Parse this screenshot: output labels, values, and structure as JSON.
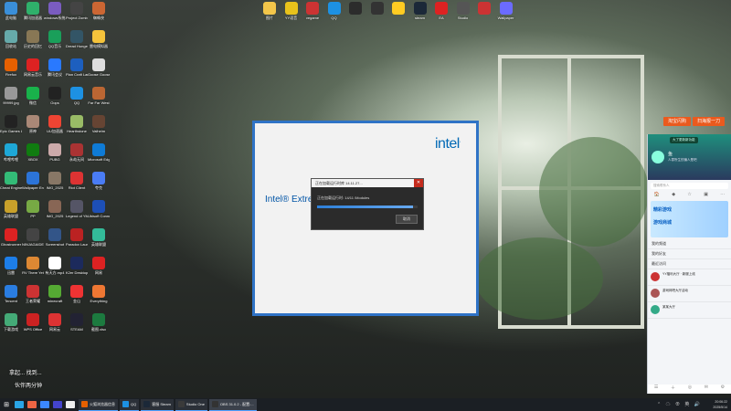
{
  "desktop_icons": [
    {
      "label": "此电脑",
      "color": "#3a8fd9"
    },
    {
      "label": "腾讯加速器",
      "color": "#2fb06b"
    },
    {
      "label": "windows系统.rar",
      "color": "#7a5cc0"
    },
    {
      "label": "Project Zomboid",
      "color": "#444"
    },
    {
      "label": "蜘蛛侠",
      "color": "#c63"
    },
    {
      "label": "回收站",
      "color": "#6aa"
    },
    {
      "label": "历史的回忆",
      "color": "#875"
    },
    {
      "label": "QQ音乐",
      "color": "#1a9f5a"
    },
    {
      "label": "Dread Hunger",
      "color": "#356"
    },
    {
      "label": "雷电模拟器",
      "color": "#f5c33b"
    },
    {
      "label": "Firefox",
      "color": "#e66000"
    },
    {
      "label": "网易云音乐",
      "color": "#d22"
    },
    {
      "label": "腾讯会议",
      "color": "#2979ff"
    },
    {
      "label": "Plan Craft Launcher",
      "color": "#1d5fbf"
    },
    {
      "label": "Goose Goose Duck",
      "color": "#ddd"
    },
    {
      "label": "99999.jpg",
      "color": "#999"
    },
    {
      "label": "微信",
      "color": "#19b24b"
    },
    {
      "label": "Oops",
      "color": "#222"
    },
    {
      "label": "QQ",
      "color": "#1d91e3"
    },
    {
      "label": "Far Far West",
      "color": "#b63"
    },
    {
      "label": "Epic Games Launcher",
      "color": "#222"
    },
    {
      "label": "原神",
      "color": "#a87"
    },
    {
      "label": "UU加速器",
      "color": "#e43"
    },
    {
      "label": "Hearthstone",
      "color": "#9b6"
    },
    {
      "label": "Valheim",
      "color": "#643"
    },
    {
      "label": "哔哩哔哩",
      "color": "#1ea7d6"
    },
    {
      "label": "XBOX",
      "color": "#107c10"
    },
    {
      "label": "PUBG",
      "color": "#caa"
    },
    {
      "label": "永劫无间",
      "color": "#a33"
    },
    {
      "label": "Microsoft Edge",
      "color": "#0f7bd6"
    },
    {
      "label": "Cheat Engine",
      "color": "#3b7"
    },
    {
      "label": "Wallpaper Engine",
      "color": "#2c74d8"
    },
    {
      "label": "IMG_2025",
      "color": "#876"
    },
    {
      "label": "Riot Client",
      "color": "#d33"
    },
    {
      "label": "夸克",
      "color": "#4a7cf5"
    },
    {
      "label": "英雄联盟",
      "color": "#c9a12a"
    },
    {
      "label": "PP",
      "color": "#7a4"
    },
    {
      "label": "IMG_2025",
      "color": "#865"
    },
    {
      "label": "Legend of YMIR",
      "color": "#556"
    },
    {
      "label": "Ubisoft Connect",
      "color": "#1d4fb6"
    },
    {
      "label": "Ghostrunner",
      "color": "#d22"
    },
    {
      "label": "NINJAGAIDEN",
      "color": "#444"
    },
    {
      "label": "Screenshot",
      "color": "#358"
    },
    {
      "label": "Paradox Launcher v2",
      "color": "#b22"
    },
    {
      "label": "英雄联盟",
      "color": "#3b9"
    },
    {
      "label": "迅雷",
      "color": "#1d7ee8"
    },
    {
      "label": "RV There Yet",
      "color": "#d83"
    },
    {
      "label": "有天方.mp4",
      "color": "#fff"
    },
    {
      "label": "K2er Desktop",
      "color": "#1c2a5c"
    },
    {
      "label": "网易",
      "color": "#d22"
    },
    {
      "label": "Tencent",
      "color": "#2a7de1"
    },
    {
      "label": "王者荣耀",
      "color": "#c33"
    },
    {
      "label": "minecraft",
      "color": "#5a3"
    },
    {
      "label": "金山",
      "color": "#e33"
    },
    {
      "label": "Everything",
      "color": "#e73"
    },
    {
      "label": "下载游戏",
      "color": "#4a7"
    },
    {
      "label": "WPS Office",
      "color": "#c22"
    },
    {
      "label": "网易云",
      "color": "#d33"
    },
    {
      "label": "STEAM",
      "color": "#223"
    },
    {
      "label": "截图.xlsx",
      "color": "#1c7a3f"
    }
  ],
  "top_icons": [
    {
      "label": "图片",
      "color": "#f3c64a"
    },
    {
      "label": "YY语音",
      "color": "#e8c21b"
    },
    {
      "label": "vegame",
      "color": "#c33"
    },
    {
      "label": "QQ",
      "color": "#1d91e3"
    },
    {
      "label": "",
      "color": "#2c2c2c"
    },
    {
      "label": "",
      "color": "#333"
    },
    {
      "label": "",
      "color": "#ffcc22"
    },
    {
      "label": "steam",
      "color": "#1b2838"
    },
    {
      "label": "EA",
      "color": "#d22"
    },
    {
      "label": "Studio",
      "color": "#555"
    },
    {
      "label": "",
      "color": "#c33"
    },
    {
      "label": "Wallpaper",
      "color": "#6b6bff"
    }
  ],
  "installer": {
    "logo": "intel",
    "title_visible": "Intel® Extre"
  },
  "dialog": {
    "title": "正在加载运行时库 14.11.27...",
    "status": "正在加载运行时: 14/11 /Modules",
    "progress": 0.95,
    "cancel_label": "取消"
  },
  "banner": {
    "left": "淘宝闪购",
    "right": "扫海报一刀"
  },
  "qq_panel": {
    "tag": "大了更新新功能",
    "name": "鱼",
    "signature": "人零所生的骗人是吧",
    "search_placeholder": "搜索联系人",
    "tabs": [
      "🏠",
      "◆",
      "☆",
      "▣",
      "⋯"
    ],
    "ad_lines": [
      "精彩游戏",
      "游戏商城"
    ],
    "sections": [
      "我的频道",
      "我的好友",
      "最近访问"
    ],
    "chats": [
      {
        "name": "YY福利大厅 · 新服上线",
        "preview": "",
        "color": "#c33"
      },
      {
        "name": "游戏网吧大厅活动",
        "preview": "",
        "color": "#a55"
      },
      {
        "name": "某某大厅",
        "preview": "",
        "color": "#3a8"
      }
    ],
    "bottom_icons": [
      "☰",
      "＋",
      "◎",
      "✉",
      "⚙"
    ]
  },
  "overlay": {
    "line1": "  拿起... 找到... ",
    "line2": "伙伴两分钟"
  },
  "taskbar": {
    "start": "⊞",
    "pins": [
      "#2aa4e6",
      "#e64",
      "#3b88ff",
      "#44c",
      "#eee"
    ],
    "apps": [
      {
        "label": "火狐浏览器信息",
        "color": "#e66000",
        "active": false
      },
      {
        "label": "QQ",
        "color": "#1d91e3",
        "active": false
      },
      {
        "label": "客服 Steam",
        "color": "#1b2838",
        "active": false
      },
      {
        "label": "Studio One",
        "color": "#3a3a3a",
        "active": false
      },
      {
        "label": "OBS 31.0.2 - 配置:...",
        "color": "#333",
        "active": true
      }
    ],
    "tray_icons": "⌃ ☁ ⊕ 英 🔊",
    "time": "20:06:22",
    "date": "2025/5/14"
  }
}
